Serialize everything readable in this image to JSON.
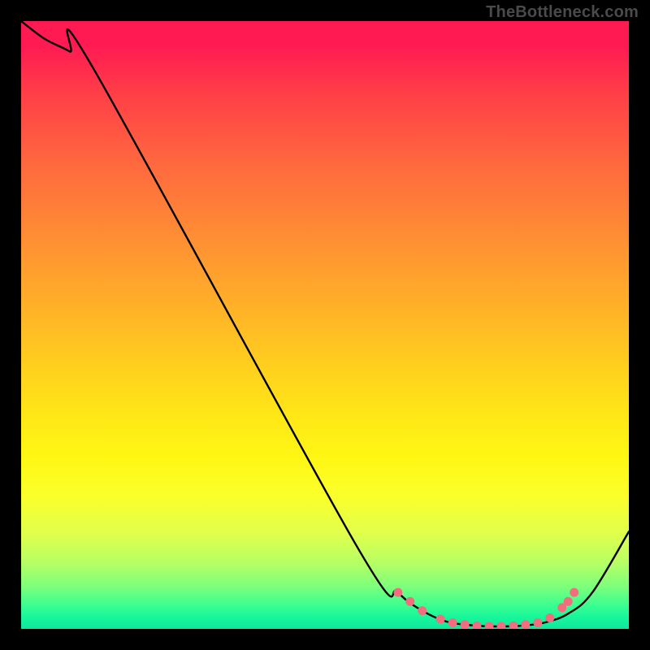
{
  "watermark": "TheBottleneck.com",
  "chart_data": {
    "type": "line",
    "title": "",
    "xlabel": "",
    "ylabel": "",
    "xlim": [
      0,
      100
    ],
    "ylim": [
      0,
      100
    ],
    "series": [
      {
        "name": "curve",
        "x": [
          0,
          4,
          8,
          12,
          55,
          62,
          66,
          70,
          74,
          78,
          82,
          86,
          90,
          94,
          100
        ],
        "y": [
          100,
          97,
          95,
          92,
          14,
          6,
          3,
          1.2,
          0.6,
          0.4,
          0.5,
          1.0,
          2.5,
          6,
          16
        ]
      }
    ],
    "markers": {
      "name": "dots",
      "color": "#f26d7d",
      "x": [
        62,
        64,
        66,
        69,
        71,
        73,
        75,
        77,
        79,
        81,
        83,
        85,
        87,
        89,
        90,
        91
      ],
      "y": [
        6,
        4.5,
        3,
        1.6,
        1.0,
        0.7,
        0.5,
        0.4,
        0.4,
        0.5,
        0.7,
        1.0,
        1.8,
        3.5,
        4.5,
        6
      ]
    },
    "gradient_stops": [
      {
        "pos": 0.0,
        "color": "#ff1a52"
      },
      {
        "pos": 0.35,
        "color": "#ff8f33"
      },
      {
        "pos": 0.65,
        "color": "#ffea16"
      },
      {
        "pos": 0.9,
        "color": "#7dff7b"
      },
      {
        "pos": 1.0,
        "color": "#0ee89d"
      }
    ]
  }
}
